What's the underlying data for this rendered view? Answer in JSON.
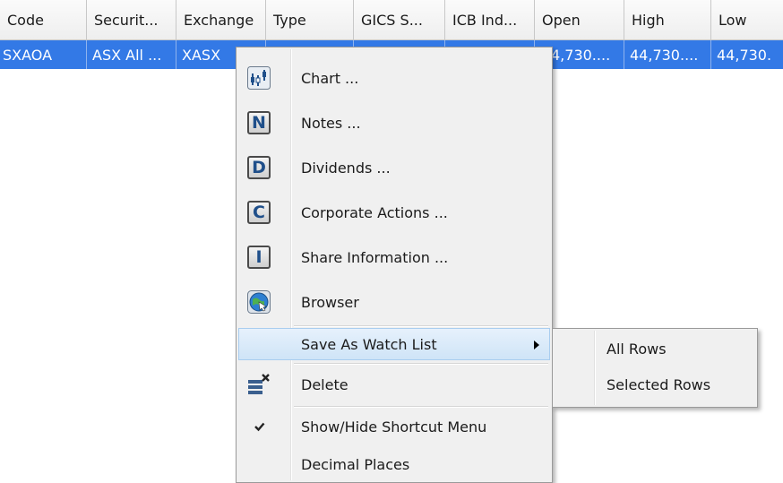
{
  "grid": {
    "columns": [
      "Code",
      "Securit...",
      "Exchange",
      "Type",
      "GICS S...",
      "ICB Ind...",
      "Open",
      "High",
      "Low"
    ],
    "selected_row": [
      "SXAOA",
      "ASX All ...",
      "XASX",
      "",
      "",
      "",
      "4,730....",
      "44,730....",
      "44,730."
    ]
  },
  "context_menu": {
    "items": [
      {
        "label": "Chart ...",
        "icon": "chart-icon"
      },
      {
        "label": "Notes ...",
        "icon": "notes-icon",
        "icon_letter": "N"
      },
      {
        "label": "Dividends ...",
        "icon": "dividends-icon",
        "icon_letter": "D"
      },
      {
        "label": "Corporate Actions ...",
        "icon": "corporate-actions-icon",
        "icon_letter": "C"
      },
      {
        "label": "Share Information ...",
        "icon": "share-information-icon",
        "icon_letter": "I"
      },
      {
        "label": "Browser",
        "icon": "globe-icon"
      },
      {
        "label": "Save As Watch List",
        "icon": "",
        "highlighted": true,
        "has_submenu": true
      },
      {
        "label": "Delete",
        "icon": "delete-icon"
      },
      {
        "label": "Show/Hide Shortcut Menu",
        "icon": "checkmark-icon"
      },
      {
        "label": "Decimal Places",
        "icon": ""
      }
    ]
  },
  "submenu": {
    "items": [
      {
        "label": "All Rows"
      },
      {
        "label": "Selected Rows"
      }
    ]
  },
  "colors": {
    "selection": "#3379e6",
    "menu_bg": "#f0f0f0",
    "highlight": "#cfe4f7",
    "icon_letter": "#1f4f8a"
  }
}
